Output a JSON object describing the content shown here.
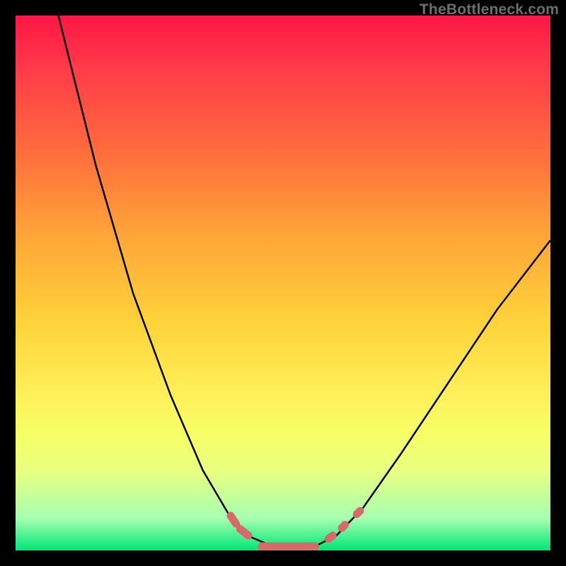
{
  "watermark": "TheBottleneck.com",
  "chart_data": {
    "type": "line",
    "title": "",
    "xlabel": "",
    "ylabel": "",
    "xlim": [
      0,
      100
    ],
    "ylim": [
      0,
      100
    ],
    "gradient_stops": [
      {
        "pos": 0,
        "color": "#ff1744"
      },
      {
        "pos": 10,
        "color": "#ff3b4a"
      },
      {
        "pos": 25,
        "color": "#ff6b3d"
      },
      {
        "pos": 42,
        "color": "#ffa838"
      },
      {
        "pos": 58,
        "color": "#ffd43b"
      },
      {
        "pos": 70,
        "color": "#ffee58"
      },
      {
        "pos": 78,
        "color": "#f7ff66"
      },
      {
        "pos": 85,
        "color": "#eaff80"
      },
      {
        "pos": 94,
        "color": "#a6ffb0"
      },
      {
        "pos": 100,
        "color": "#00e676"
      }
    ],
    "series": [
      {
        "name": "black-curve",
        "stroke": "#000000",
        "stroke_width": 2.5,
        "points": [
          {
            "x": 8.0,
            "y": 100.0
          },
          {
            "x": 15.0,
            "y": 72.0
          },
          {
            "x": 22.0,
            "y": 48.0
          },
          {
            "x": 29.0,
            "y": 29.0
          },
          {
            "x": 35.0,
            "y": 15.0
          },
          {
            "x": 40.0,
            "y": 6.5
          },
          {
            "x": 44.0,
            "y": 2.5
          },
          {
            "x": 48.0,
            "y": 0.8
          },
          {
            "x": 52.0,
            "y": 0.5
          },
          {
            "x": 56.0,
            "y": 0.8
          },
          {
            "x": 60.0,
            "y": 2.8
          },
          {
            "x": 65.0,
            "y": 8.0
          },
          {
            "x": 72.0,
            "y": 18.0
          },
          {
            "x": 80.0,
            "y": 30.0
          },
          {
            "x": 90.0,
            "y": 45.0
          },
          {
            "x": 100.0,
            "y": 58.0
          }
        ]
      },
      {
        "name": "salmon-markers",
        "stroke": "#d46a6a",
        "stroke_width": 11,
        "stroke_linecap": "round",
        "segments": [
          [
            {
              "x": 40.2,
              "y": 6.5
            },
            {
              "x": 41.2,
              "y": 5.0
            }
          ],
          [
            {
              "x": 42.0,
              "y": 4.0
            },
            {
              "x": 43.5,
              "y": 2.8
            }
          ],
          [
            {
              "x": 46.0,
              "y": 0.8
            },
            {
              "x": 56.0,
              "y": 0.8
            }
          ],
          [
            {
              "x": 58.5,
              "y": 2.2
            },
            {
              "x": 59.3,
              "y": 2.8
            }
          ],
          [
            {
              "x": 61.0,
              "y": 4.2
            },
            {
              "x": 61.6,
              "y": 4.8
            }
          ],
          [
            {
              "x": 63.8,
              "y": 6.8
            },
            {
              "x": 64.4,
              "y": 7.4
            }
          ]
        ]
      }
    ]
  }
}
